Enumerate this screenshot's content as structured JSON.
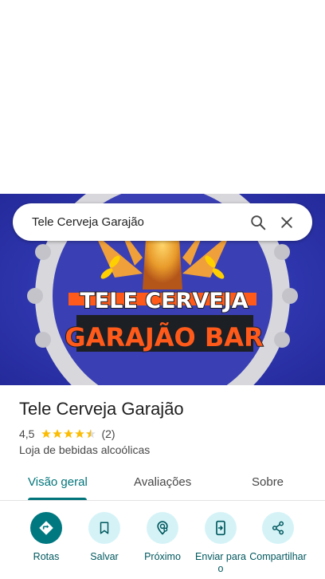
{
  "search": {
    "query": "Tele Cerveja Garajão"
  },
  "hero": {
    "line1": "TELE CERVEJA",
    "line2": "GARAJÃO BAR"
  },
  "place": {
    "name": "Tele Cerveja Garajão",
    "rating": "4,5",
    "rating_value": 4.5,
    "reviews": "(2)",
    "category": "Loja de bebidas alcoólicas"
  },
  "tabs": [
    {
      "label": "Visão geral",
      "active": true
    },
    {
      "label": "Avaliações",
      "active": false
    },
    {
      "label": "Sobre",
      "active": false
    }
  ],
  "actions": [
    {
      "label": "Rotas",
      "icon": "directions-icon",
      "primary": true
    },
    {
      "label": "Salvar",
      "icon": "bookmark-icon",
      "primary": false
    },
    {
      "label": "Próximo",
      "icon": "nearby-icon",
      "primary": false
    },
    {
      "label": "Enviar para o",
      "icon": "send-to-phone-icon",
      "primary": false
    },
    {
      "label": "Compartilhar",
      "icon": "share-icon",
      "primary": false
    }
  ],
  "colors": {
    "accent": "#00747a",
    "star": "#fbbc04",
    "hero_bg": "#2a2fa8",
    "hero_text_orange": "#ff5a1a"
  }
}
